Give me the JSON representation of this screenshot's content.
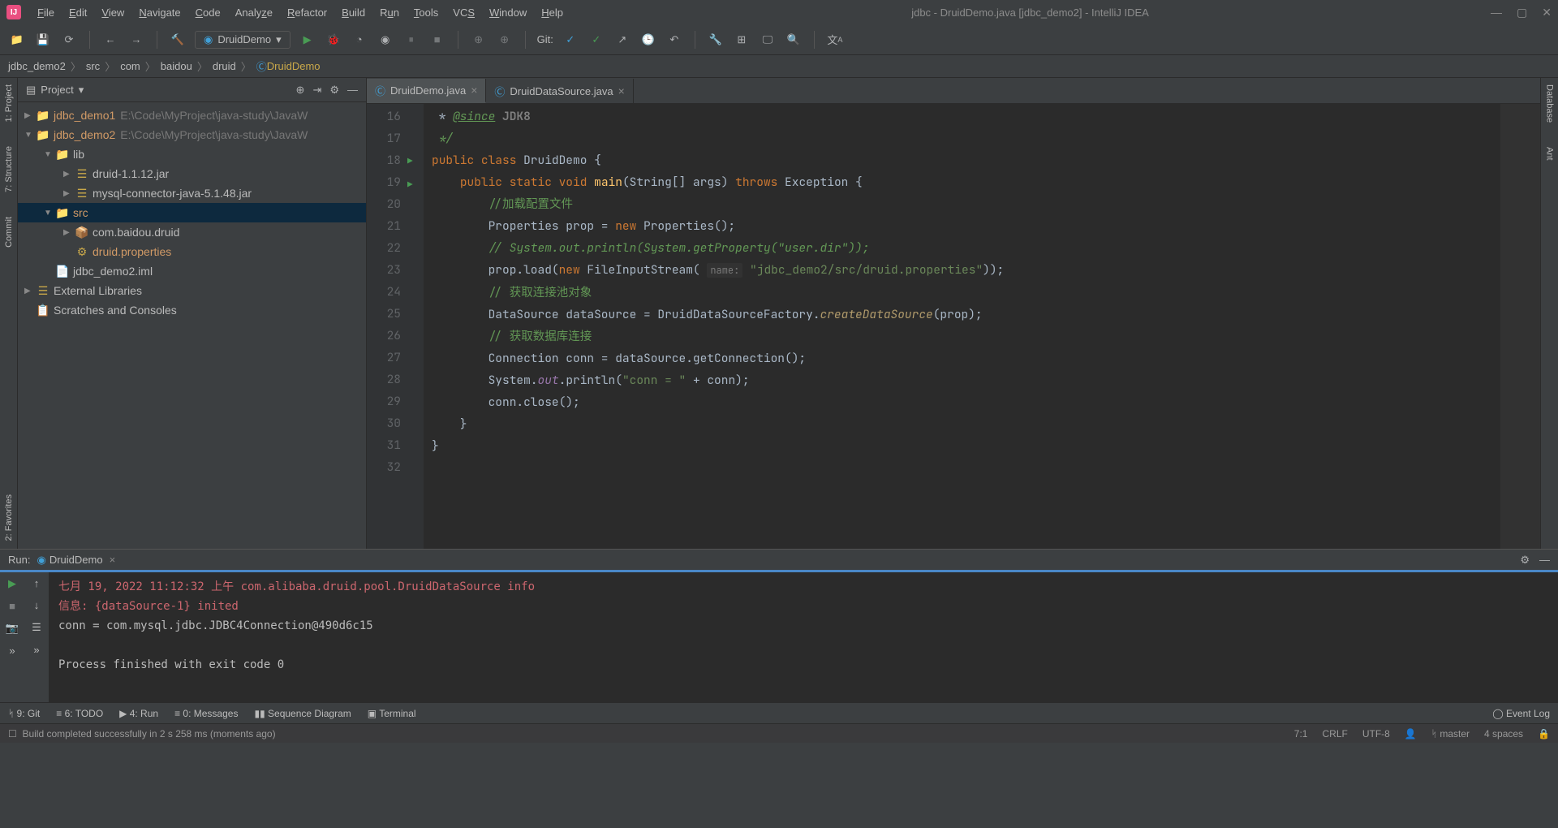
{
  "title": "jdbc - DruidDemo.java [jdbc_demo2] - IntelliJ IDEA",
  "menu": [
    "File",
    "Edit",
    "View",
    "Navigate",
    "Code",
    "Analyze",
    "Refactor",
    "Build",
    "Run",
    "Tools",
    "VCS",
    "Window",
    "Help"
  ],
  "runConfig": "DruidDemo",
  "gitLabel": "Git:",
  "breadcrumb": [
    "jdbc_demo2",
    "src",
    "com",
    "baidou",
    "druid",
    "DruidDemo"
  ],
  "projectPanel": {
    "title": "Project"
  },
  "tree": {
    "demo1": "jdbc_demo1",
    "demo1path": "E:\\Code\\MyProject\\java-study\\JavaW",
    "demo2": "jdbc_demo2",
    "demo2path": "E:\\Code\\MyProject\\java-study\\JavaW",
    "lib": "lib",
    "druidjar": "druid-1.1.12.jar",
    "mysqljar": "mysql-connector-java-5.1.48.jar",
    "src": "src",
    "pkg": "com.baidou.druid",
    "props": "druid.properties",
    "iml": "jdbc_demo2.iml",
    "extlib": "External Libraries",
    "scratch": "Scratches and Consoles"
  },
  "tabs": [
    {
      "label": "DruidDemo.java",
      "active": true
    },
    {
      "label": "DruidDataSource.java",
      "active": false
    }
  ],
  "code": {
    "lines": [
      16,
      17,
      18,
      19,
      20,
      21,
      22,
      23,
      24,
      25,
      26,
      27,
      28,
      29,
      30,
      31,
      32
    ],
    "l16": " * @since JDK8",
    "l17": " */",
    "l21a": "Properties prop = ",
    "l21b": "new",
    "l21c": " Properties();",
    "l22": "// System.out.println(System.getProperty(\"user.dir\"));",
    "l23a": "prop.load(",
    "l23b": "new",
    "l23c": " FileInputStream( ",
    "l23name": "name:",
    "l23str": "\"jdbc_demo2/src/druid.properties\"",
    "l23d": "));",
    "l25": "DataSource dataSource = DruidDataSourceFactory.",
    "l25m": "createDataSource",
    "l25e": "(prop);",
    "l27": "Connection conn = dataSource.getConnection();",
    "l28a": "System.",
    "l28b": "out",
    "l28c": ".println(",
    "l28str": "\"conn = \"",
    "l28d": " + conn);",
    "l29": "conn.close();",
    "c20": "//加载配置文件",
    "c24": "// 获取连接池对象",
    "c26": "// 获取数据库连接"
  },
  "run": {
    "label": "Run:",
    "config": "DruidDemo",
    "l1": "七月 19, 2022 11:12:32 上午 com.alibaba.druid.pool.DruidDataSource info",
    "l2": "信息: {dataSource-1} inited",
    "l3": "conn = com.mysql.jdbc.JDBC4Connection@490d6c15",
    "l4": "",
    "l5": "Process finished with exit code 0"
  },
  "bottomTabs": {
    "git": "9: Git",
    "todo": "6: TODO",
    "run": "4: Run",
    "msg": "0: Messages",
    "seq": "Sequence Diagram",
    "term": "Terminal",
    "eventlog": "Event Log"
  },
  "status": {
    "build": "Build completed successfully in 2 s 258 ms (moments ago)",
    "pos": "7:1",
    "eol": "CRLF",
    "enc": "UTF-8",
    "branch": "master",
    "indent": "4 spaces"
  },
  "leftGutter": {
    "project": "1: Project",
    "structure": "7: Structure",
    "commit": "Commit",
    "fav": "2: Favorites"
  },
  "rightGutter": {
    "db": "Database",
    "ant": "Ant"
  }
}
